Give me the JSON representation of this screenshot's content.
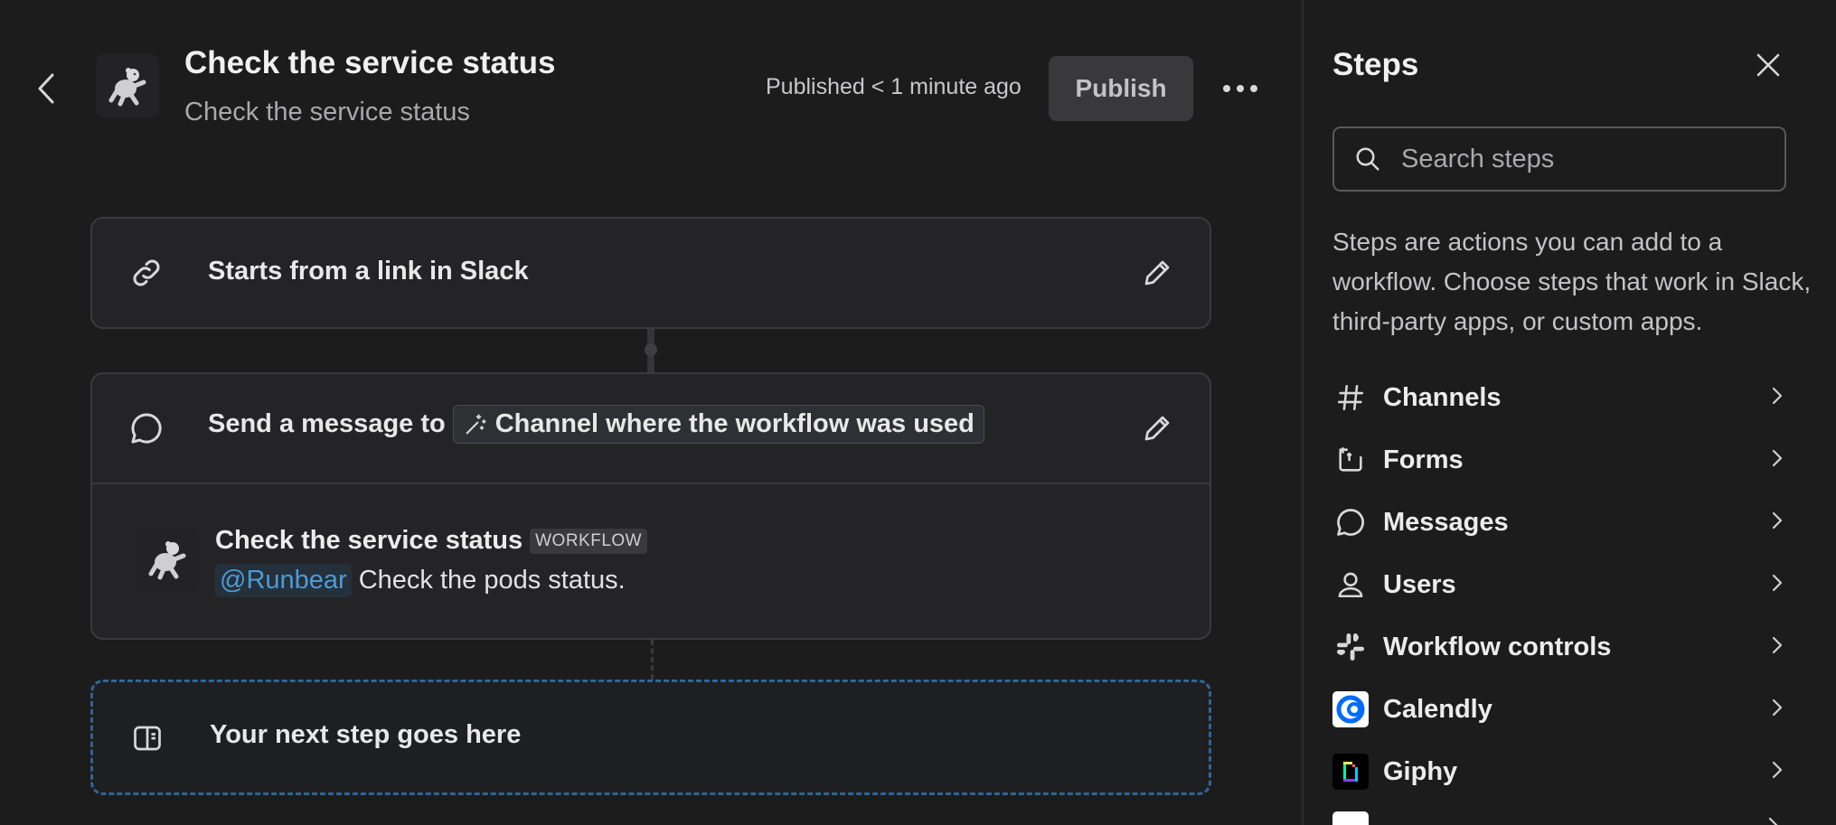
{
  "header": {
    "title": "Check the service status",
    "subtitle": "Check the service status",
    "published_status": "Published < 1 minute ago",
    "publish_label": "Publish"
  },
  "steps_canvas": {
    "trigger": {
      "label": "Starts from a link in Slack"
    },
    "message_step": {
      "prefix": "Send a message to",
      "channel_chip": "Channel where the workflow was used",
      "preview": {
        "sender": "Check the service status",
        "badge": "WORKFLOW",
        "mention": "@Runbear",
        "text": "Check the pods status."
      }
    },
    "next_step_placeholder": "Your next step goes here"
  },
  "steps_panel": {
    "title": "Steps",
    "search_placeholder": "Search steps",
    "description": "Steps are actions you can add to a workflow. Choose steps that work in Slack, third-party apps, or custom apps.",
    "categories": [
      {
        "label": "Channels",
        "icon": "hash-icon"
      },
      {
        "label": "Forms",
        "icon": "form-icon"
      },
      {
        "label": "Messages",
        "icon": "message-icon"
      },
      {
        "label": "Users",
        "icon": "user-icon"
      },
      {
        "label": "Workflow controls",
        "icon": "slack-logo-icon"
      },
      {
        "label": "Calendly",
        "icon": "calendly-logo-icon"
      },
      {
        "label": "Giphy",
        "icon": "giphy-logo-icon"
      }
    ]
  },
  "colors": {
    "background": "#1c1c1d",
    "card": "#242426",
    "accent_dashed": "#2f6596",
    "mention": "#4e9ad6"
  }
}
